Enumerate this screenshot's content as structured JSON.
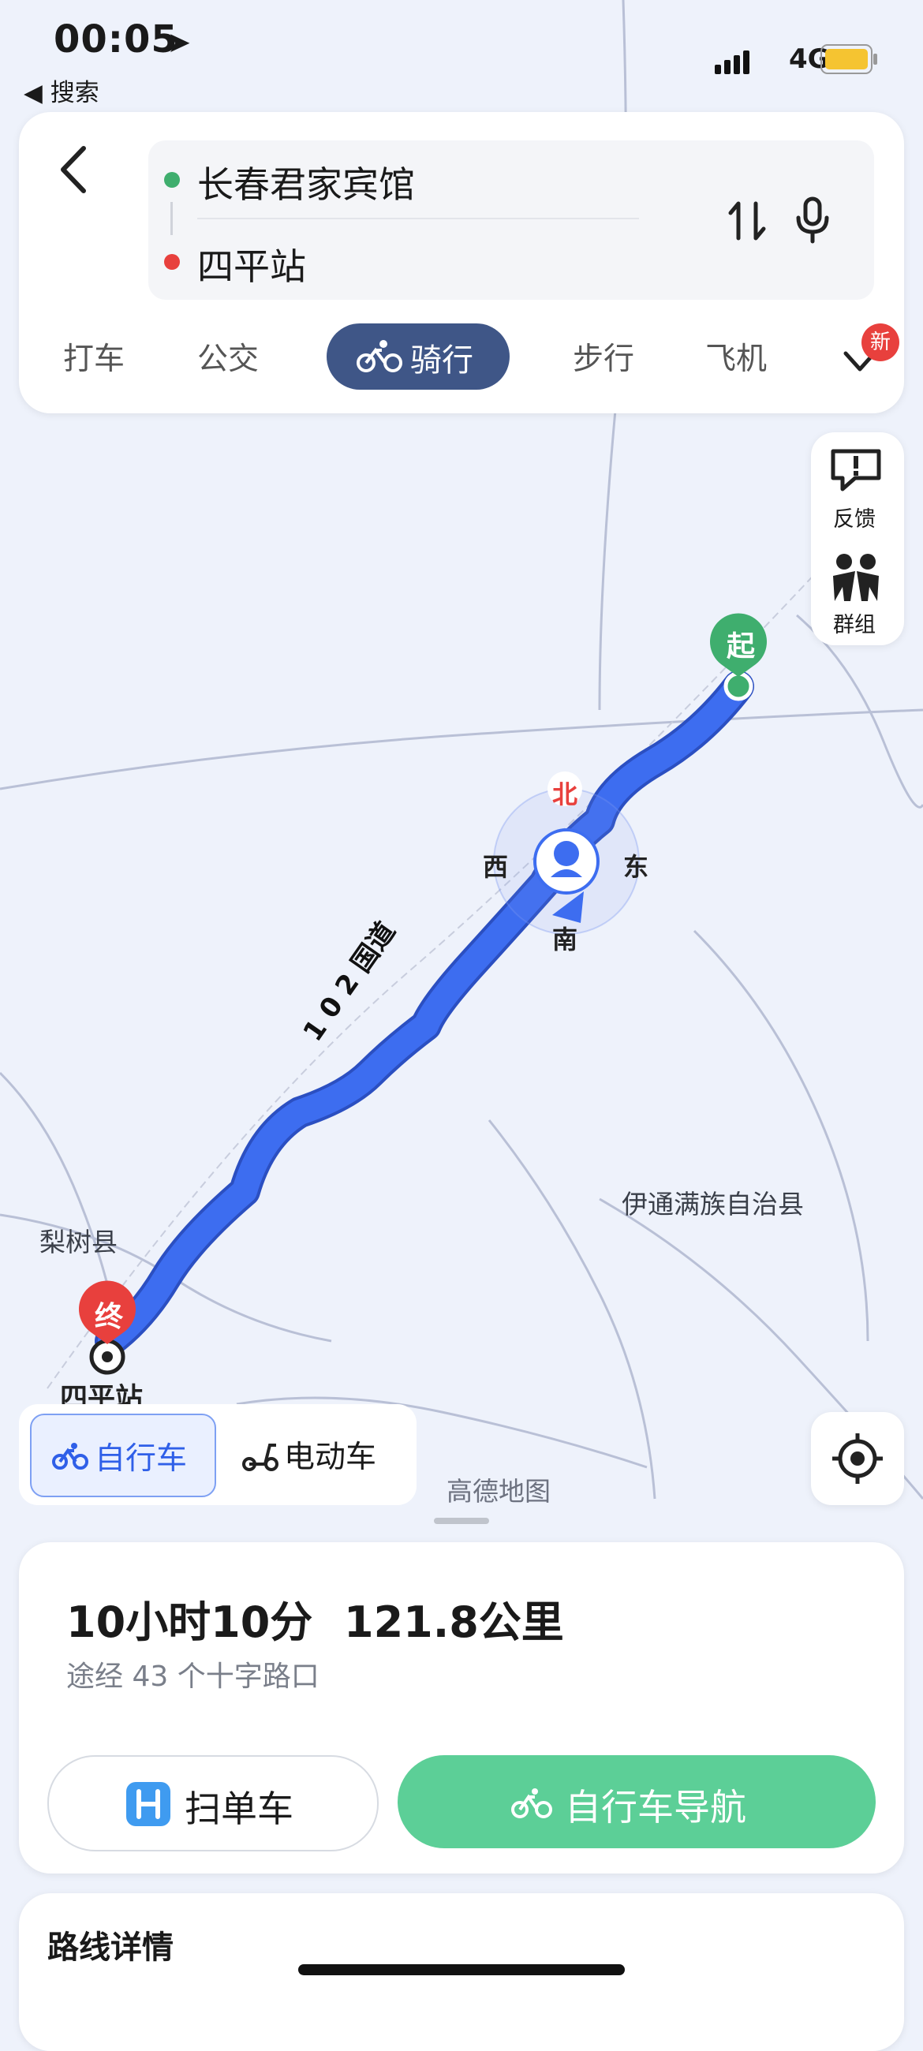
{
  "status": {
    "time": "00:05",
    "back_label": "◀ 搜索",
    "network": "4G"
  },
  "route": {
    "start": "长春君家宾馆",
    "end": "四平站"
  },
  "tabs": [
    "打车",
    "公交",
    "骑行",
    "步行",
    "飞机"
  ],
  "new_badge": "新",
  "side": {
    "feedback": "反馈",
    "group": "群组"
  },
  "map": {
    "start_marker": "起",
    "end_marker": "终",
    "compass": {
      "n": "北",
      "s": "南",
      "w": "西",
      "e": "东"
    },
    "road_label": "1 0 2 国道",
    "labels": {
      "county_right": "伊通满族自治县",
      "county_left": "梨树县",
      "end_station": "四平站",
      "watermark": "高德地图"
    }
  },
  "mode": {
    "bike": "自行车",
    "ebike": "电动车"
  },
  "summary": {
    "duration": "10小时10分",
    "distance": "121.8公里",
    "intersections": "途经 43 个十字路口"
  },
  "buttons": {
    "scan": "扫单车",
    "navigate": "自行车导航"
  },
  "details_title": "路线详情",
  "colors": {
    "route_blue": "#3d6df0",
    "nav_green": "#5ccf97",
    "active_tab": "#3f5687",
    "start_green": "#3fae6e",
    "end_red": "#e8403d"
  }
}
